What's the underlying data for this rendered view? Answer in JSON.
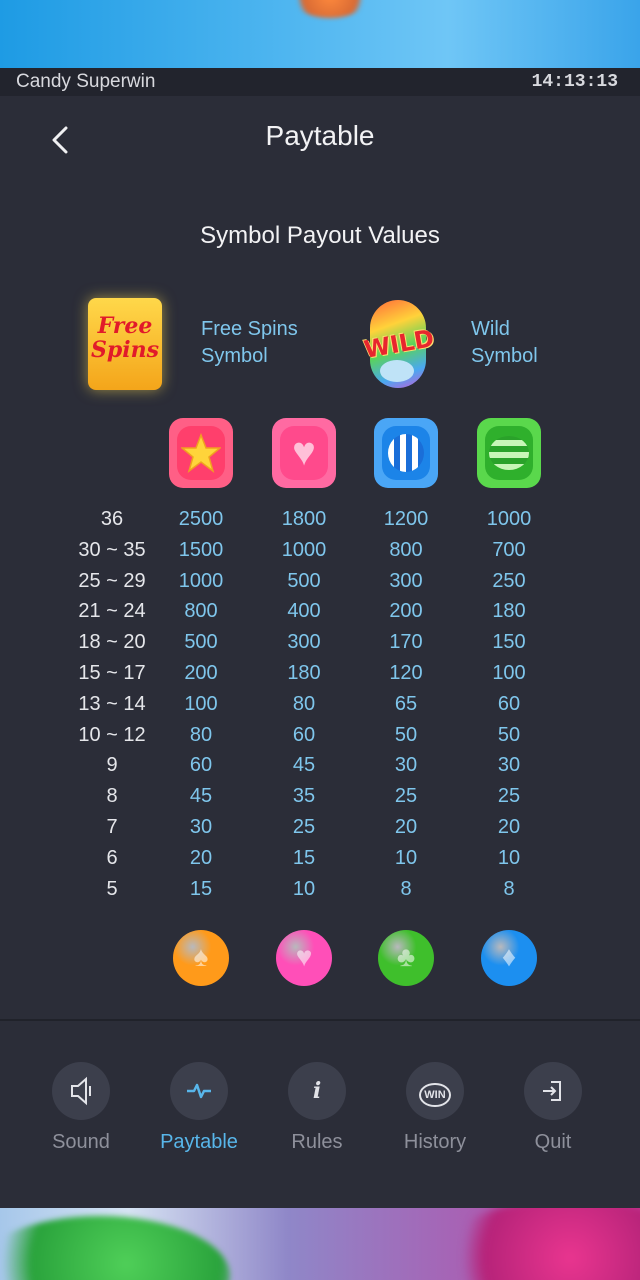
{
  "app_title": "Candy Superwin",
  "clock": "14:13:13",
  "page_title": "Paytable",
  "section_title": "Symbol Payout Values",
  "special_symbols": [
    {
      "icon": "free-spins-icon",
      "label_line1": "Free Spins",
      "label_line2": "Symbol",
      "icon_text_1": "Free",
      "icon_text_2": "Spins"
    },
    {
      "icon": "wild-icon",
      "label_line1": "Wild",
      "label_line2": "Symbol",
      "icon_text": "WILD"
    }
  ],
  "top_symbols": [
    {
      "icon": "star-candy-icon",
      "color": "#ff5a7a"
    },
    {
      "icon": "heart-candy-icon",
      "color": "#ff4f8a"
    },
    {
      "icon": "blue-striped-candy-icon",
      "color": "#2f8ff0"
    },
    {
      "icon": "green-striped-candy-icon",
      "color": "#3ec23c"
    }
  ],
  "bottom_symbols": [
    {
      "icon": "spade-ball-icon",
      "color": "#ff9a1a",
      "glyph": "♠"
    },
    {
      "icon": "heart-ball-icon",
      "color": "#ff4fb8",
      "glyph": "♥"
    },
    {
      "icon": "club-ball-icon",
      "color": "#3fbf2c",
      "glyph": "♣"
    },
    {
      "icon": "diamond-ball-icon",
      "color": "#1c8ff0",
      "glyph": "♦"
    }
  ],
  "payout_rows": [
    {
      "count": "36",
      "values": [
        "2500",
        "1800",
        "1200",
        "1000"
      ]
    },
    {
      "count": "30 ~ 35",
      "values": [
        "1500",
        "1000",
        "800",
        "700"
      ]
    },
    {
      "count": "25 ~ 29",
      "values": [
        "1000",
        "500",
        "300",
        "250"
      ]
    },
    {
      "count": "21 ~ 24",
      "values": [
        "800",
        "400",
        "200",
        "180"
      ]
    },
    {
      "count": "18 ~ 20",
      "values": [
        "500",
        "300",
        "170",
        "150"
      ]
    },
    {
      "count": "15 ~ 17",
      "values": [
        "200",
        "180",
        "120",
        "100"
      ]
    },
    {
      "count": "13 ~ 14",
      "values": [
        "100",
        "80",
        "65",
        "60"
      ]
    },
    {
      "count": "10 ~ 12",
      "values": [
        "80",
        "60",
        "50",
        "50"
      ]
    },
    {
      "count": "9",
      "values": [
        "60",
        "45",
        "30",
        "30"
      ]
    },
    {
      "count": "8",
      "values": [
        "45",
        "35",
        "25",
        "25"
      ]
    },
    {
      "count": "7",
      "values": [
        "30",
        "25",
        "20",
        "20"
      ]
    },
    {
      "count": "6",
      "values": [
        "20",
        "15",
        "10",
        "10"
      ]
    },
    {
      "count": "5",
      "values": [
        "15",
        "10",
        "8",
        "8"
      ]
    }
  ],
  "nav": [
    {
      "label": "Sound",
      "icon": "speaker-icon",
      "active": false
    },
    {
      "label": "Paytable",
      "icon": "pulse-icon",
      "active": true
    },
    {
      "label": "Rules",
      "icon": "info-icon",
      "active": false
    },
    {
      "label": "History",
      "icon": "win-history-icon",
      "active": false,
      "icon_text": "WIN"
    },
    {
      "label": "Quit",
      "icon": "exit-icon",
      "active": false
    }
  ],
  "colors": {
    "accent": "#58b6ea",
    "value": "#7fc6ec",
    "panel": "#2b2d38"
  }
}
